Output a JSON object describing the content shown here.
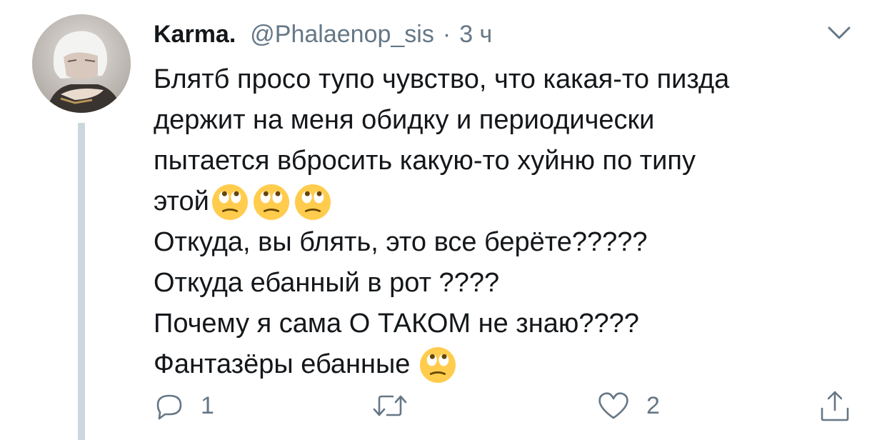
{
  "tweet": {
    "author": {
      "display_name": "Karma.",
      "handle": "@Phalaenop_sis",
      "separator": "·",
      "time": "3 ч"
    },
    "icons": {
      "more": "chevron-down-icon",
      "emoji": "face-with-rolling-eyes"
    },
    "lines": [
      "Блятб просо тупо чувство, что какая-то пизда",
      "держит на меня обидку и периодически",
      "пытается вбросить какую-то хуйню по типу",
      "этой",
      "Откуда, вы блять, это все берёте?????",
      "Откуда ебанный в рот ????",
      "Почему я сама О ТАКОМ не знаю????",
      "Фантазёры ебанные"
    ],
    "actions": {
      "reply_count": "1",
      "like_count": "2"
    },
    "colors": {
      "text": "#14171a",
      "secondary": "#657786",
      "thread_line": "#ccd6dd",
      "emoji_face": "#ffcc4d"
    }
  }
}
